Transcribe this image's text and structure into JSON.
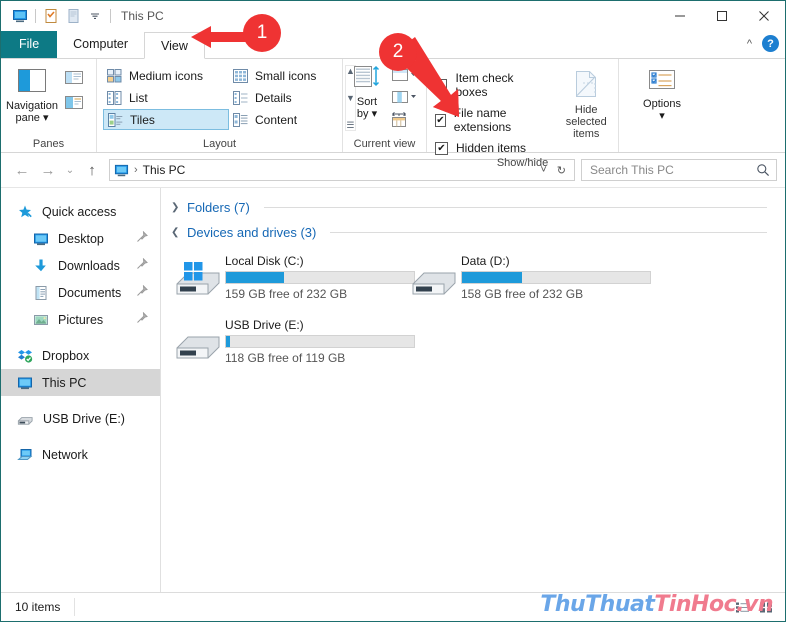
{
  "window": {
    "title": "This PC",
    "controls": {
      "minimize": "minimize-icon",
      "maximize": "maximize-icon",
      "close": "close-icon"
    },
    "quick_access_toolbar": [
      {
        "name": "properties-icon"
      },
      {
        "name": "new-folder-icon"
      },
      {
        "name": "customize-dropdown-icon"
      }
    ]
  },
  "ribbon": {
    "tabs": [
      {
        "label": "File",
        "state": "file"
      },
      {
        "label": "Computer",
        "state": "normal"
      },
      {
        "label": "View",
        "state": "active"
      }
    ],
    "collapse_icon": "chevron-up-icon",
    "help_label": "?",
    "groups": {
      "panes": {
        "label": "Panes",
        "navigation_pane": "Navigation\npane",
        "navigation_pane_line1": "Navigation",
        "navigation_pane_line2": "pane",
        "preview_pane": "preview-pane-icon",
        "details_pane": "details-pane-icon"
      },
      "layout": {
        "label": "Layout",
        "items": [
          {
            "label": "Medium icons",
            "selected": false
          },
          {
            "label": "Small icons",
            "selected": false
          },
          {
            "label": "List",
            "selected": false
          },
          {
            "label": "Details",
            "selected": false
          },
          {
            "label": "Tiles",
            "selected": true
          },
          {
            "label": "Content",
            "selected": false
          }
        ],
        "scroll_up": "▲",
        "scroll_down": "▼",
        "scroll_more": "☰"
      },
      "current_view": {
        "label": "Current view",
        "sort_by_line1": "Sort",
        "sort_by_line2": "by",
        "add_columns": "add-columns-icon",
        "size_columns": "size-all-columns-icon",
        "group_by": "group-by-icon"
      },
      "show_hide": {
        "label": "Show/hide",
        "checkboxes": [
          {
            "label": "Item check boxes",
            "checked": false
          },
          {
            "label": "File name extensions",
            "checked": true
          },
          {
            "label": "Hidden items",
            "checked": true
          }
        ],
        "hide_selected_line1": "Hide selected",
        "hide_selected_line2": "items"
      },
      "options": {
        "label": "",
        "options_label": "Options"
      }
    }
  },
  "address_bar": {
    "back": "back-arrow-icon",
    "forward": "forward-arrow-icon",
    "recent": "chevron-down-icon",
    "up": "up-arrow-icon",
    "breadcrumb": "This PC",
    "breadcrumb_separator": "›",
    "dropdown": "˅",
    "refresh": "↻",
    "search_placeholder": "Search This PC",
    "search_value": "",
    "search_icon": "search-icon"
  },
  "sidebar": {
    "items": [
      {
        "label": "Quick access",
        "icon": "star-pin-icon",
        "indent": false,
        "pinned": false,
        "selected": false
      },
      {
        "label": "Desktop",
        "icon": "desktop-icon",
        "indent": true,
        "pinned": true,
        "selected": false
      },
      {
        "label": "Downloads",
        "icon": "downloads-icon",
        "indent": true,
        "pinned": true,
        "selected": false
      },
      {
        "label": "Documents",
        "icon": "documents-icon",
        "indent": true,
        "pinned": true,
        "selected": false
      },
      {
        "label": "Pictures",
        "icon": "pictures-icon",
        "indent": true,
        "pinned": true,
        "selected": false
      },
      {
        "label": "Dropbox",
        "icon": "dropbox-icon",
        "indent": false,
        "pinned": false,
        "selected": false
      },
      {
        "label": "This PC",
        "icon": "this-pc-icon",
        "indent": false,
        "pinned": false,
        "selected": true
      },
      {
        "label": "USB Drive (E:)",
        "icon": "usb-drive-icon",
        "indent": false,
        "pinned": false,
        "selected": false
      },
      {
        "label": "Network",
        "icon": "network-icon",
        "indent": false,
        "pinned": false,
        "selected": false
      }
    ],
    "pin_glyph": "📌"
  },
  "main": {
    "groups": [
      {
        "title": "Folders (7)",
        "expanded": false
      },
      {
        "title": "Devices and drives (3)",
        "expanded": true
      }
    ],
    "folders_title": "Folders (7)",
    "devices_title": "Devices and drives (3)",
    "drives": [
      {
        "name": "Local Disk (C:)",
        "free_text": "159 GB free of 232 GB",
        "used_percent": 31,
        "system": true
      },
      {
        "name": "Data (D:)",
        "free_text": "158 GB free of 232 GB",
        "used_percent": 32,
        "system": false
      },
      {
        "name": "USB Drive (E:)",
        "free_text": "118 GB free of 119 GB",
        "used_percent": 2,
        "system": false
      }
    ]
  },
  "status_bar": {
    "item_count": "10 items",
    "view_buttons": [
      {
        "name": "details-view-button"
      },
      {
        "name": "large-icons-view-button"
      }
    ]
  },
  "watermark": {
    "part1": "ThuThuat",
    "part2": "TinHoc",
    "part3": ".vn"
  },
  "annotations": [
    {
      "id": "1",
      "label": "1",
      "points_to": "view-tab"
    },
    {
      "id": "2",
      "label": "2",
      "points_to": "hidden-items-checkbox"
    }
  ],
  "colors": {
    "file_tab": "#0d7a85",
    "accent_blue": "#1e9ada",
    "group_header": "#1668b5",
    "annotation_red": "#ef3333",
    "selection": "#cde8f7"
  }
}
